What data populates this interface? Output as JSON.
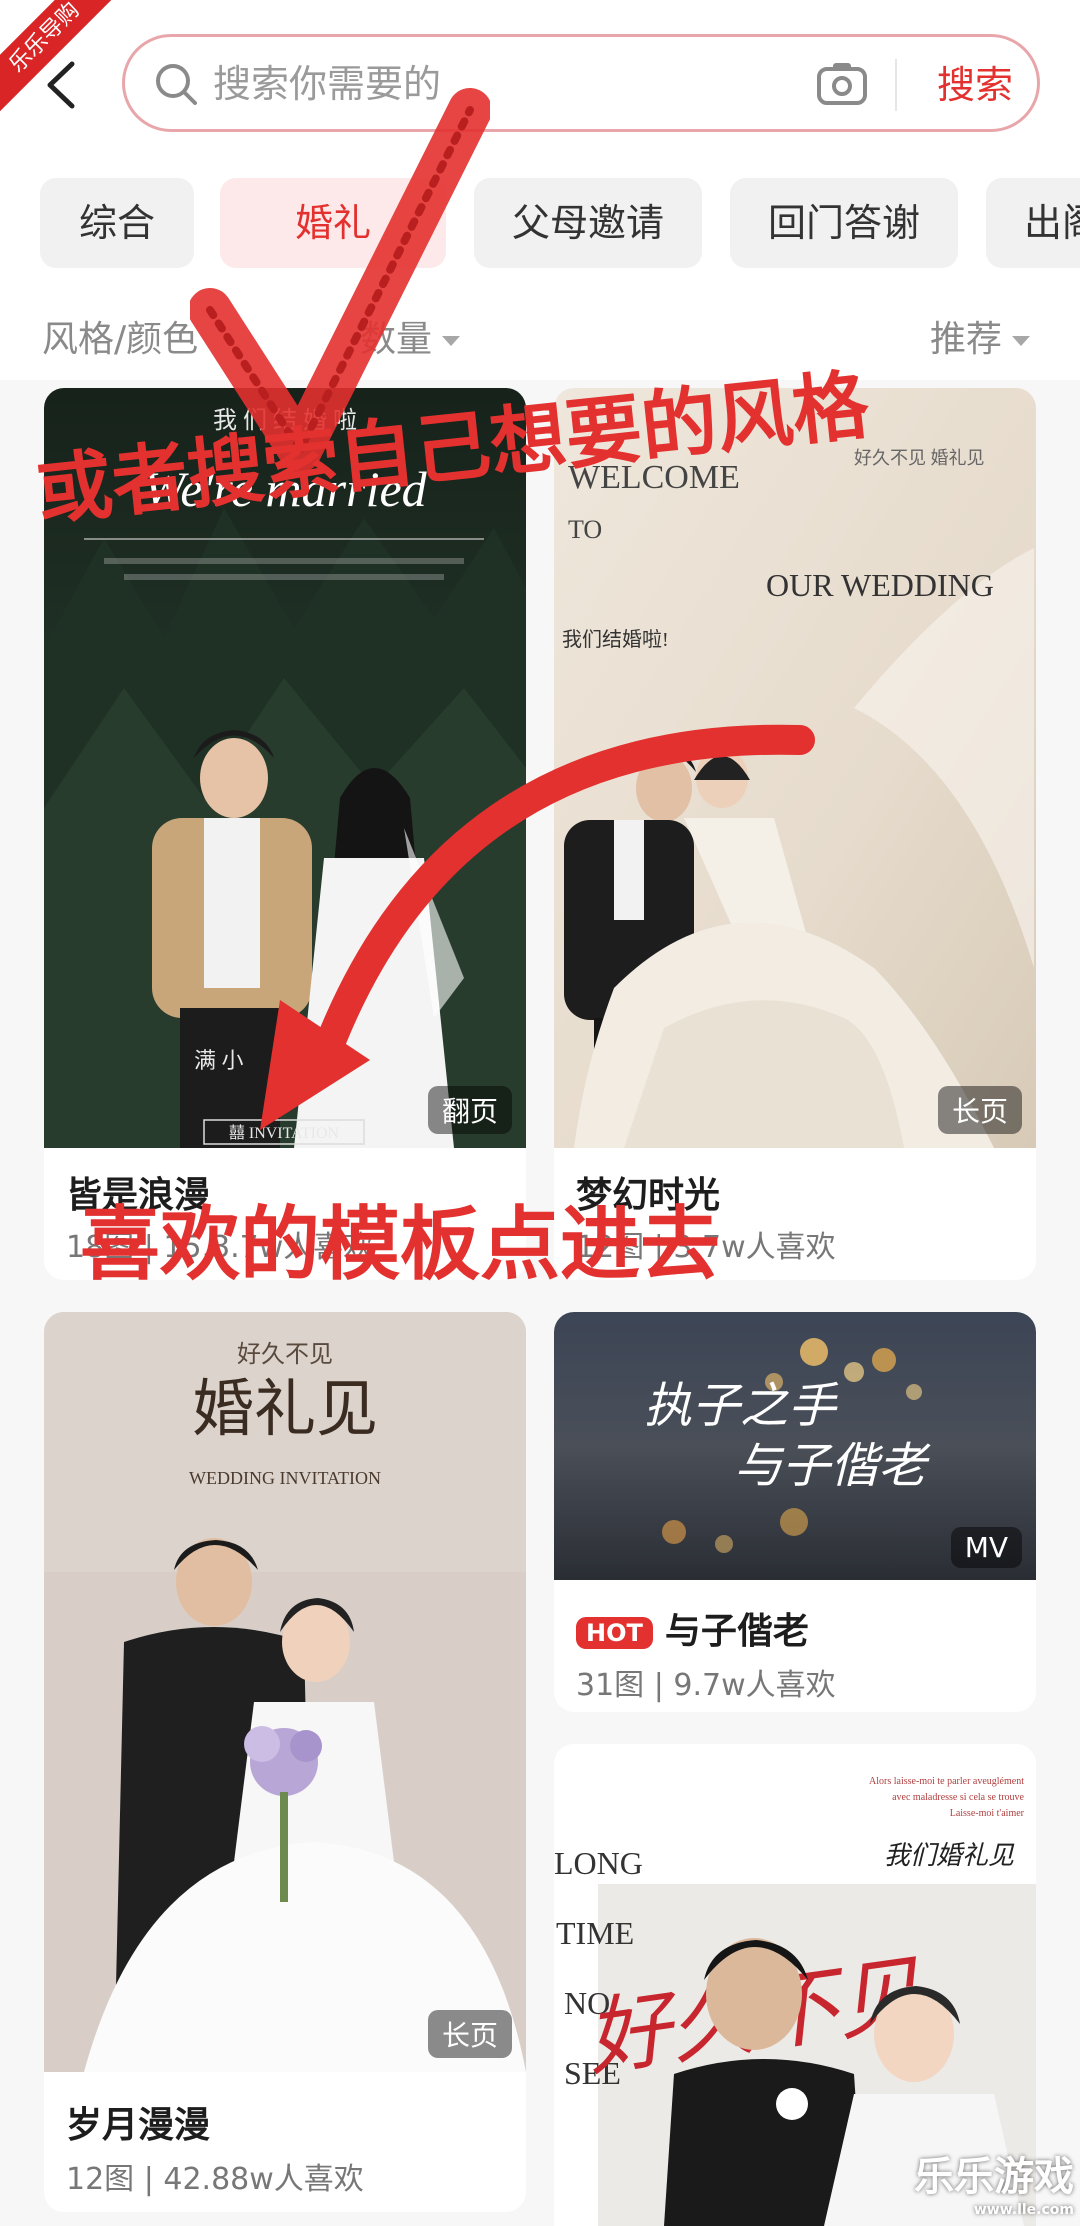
{
  "header": {
    "search_placeholder": "搜索你需要的",
    "search_button": "搜索"
  },
  "tabs": [
    {
      "label": "综合"
    },
    {
      "label": "婚礼"
    },
    {
      "label": "父母邀请"
    },
    {
      "label": "回门答谢"
    },
    {
      "label": "出阁"
    }
  ],
  "filters": {
    "style_color": "风格/颜色",
    "count": "数量",
    "sort": "推荐"
  },
  "cards": [
    {
      "title": "皆是浪漫",
      "meta": "18图 | 15.3.7w人喜欢",
      "badge": "翻页",
      "img_texts": [
        "我 们 结 婚 啦",
        "We're married",
        "满 小",
        "囍 INVITATION"
      ]
    },
    {
      "title": "梦幻时光",
      "meta": "12图 | 3.7w人喜欢",
      "badge": "长页",
      "img_texts": [
        "WELCOME",
        "TO",
        "OUR WEDDING",
        "我们结婚啦!",
        "好久不见 婚礼见"
      ]
    },
    {
      "title": "岁月漫漫",
      "meta": "12图 | 42.88w人喜欢",
      "badge": "长页",
      "img_texts": [
        "好久不见",
        "婚礼见",
        "WEDDING INVITATION"
      ]
    },
    {
      "title": "与子偕老",
      "meta": "31图 | 9.7w人喜欢",
      "badge": "MV",
      "hot": "HOT",
      "img_texts": [
        "执子之手",
        "与子偕老"
      ]
    },
    {
      "img_texts": [
        "LONG",
        "TIME",
        "NO",
        "SEE",
        "好久不见",
        "我们婚礼见",
        "Alors laisse-moi te parler aveuglément",
        "avec maladresse si cela se trouve",
        "Laisse-moi t'aimer"
      ]
    }
  ],
  "overlays": {
    "annotation_top": "或者搜索自己想要的风格",
    "annotation_bottom": "喜欢的模板点进去",
    "corner_badge": "乐乐导购",
    "watermark": "乐乐游戏",
    "watermark_url": "www.lle.com"
  },
  "colors": {
    "accent": "#e3312f",
    "search_border": "#e8a6aa",
    "page_bg": "#f7f7f7"
  }
}
